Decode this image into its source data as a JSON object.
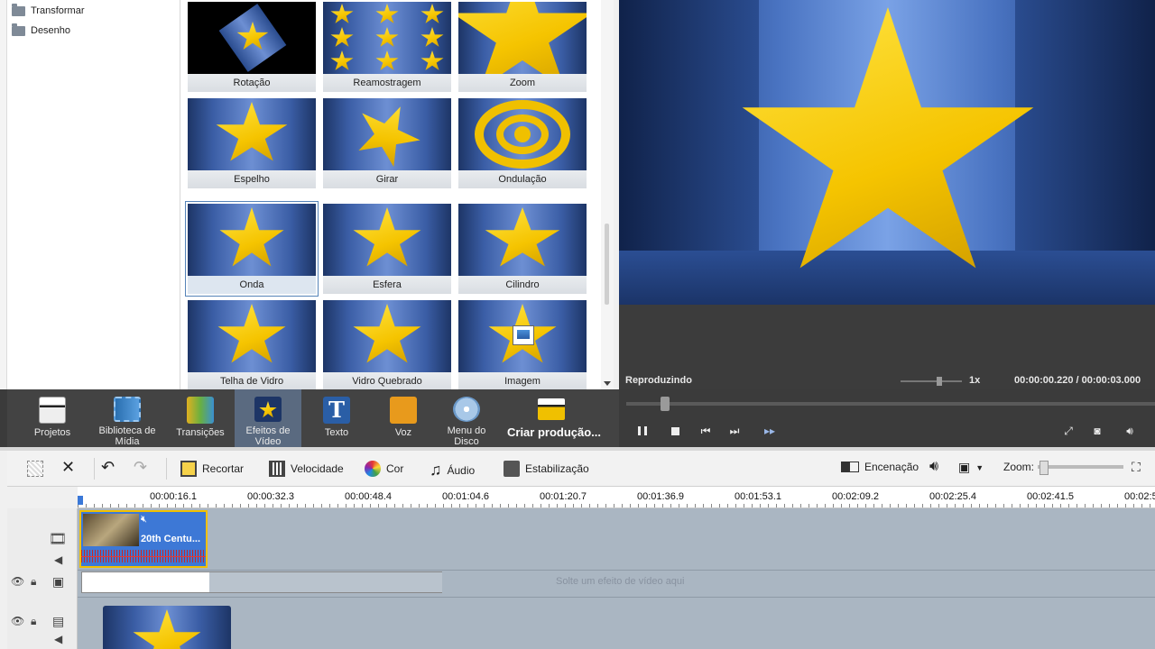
{
  "tree": {
    "items": [
      {
        "label": "Transformar"
      },
      {
        "label": "Desenho"
      }
    ]
  },
  "effects": {
    "tiles": [
      {
        "label": "Rotação"
      },
      {
        "label": "Reamostragem"
      },
      {
        "label": "Zoom"
      },
      {
        "label": "Espelho"
      },
      {
        "label": "Girar"
      },
      {
        "label": "Ondulação"
      },
      {
        "label": "Onda"
      },
      {
        "label": "Esfera"
      },
      {
        "label": "Cilindro"
      },
      {
        "label": "Telha de Vidro"
      },
      {
        "label": "Vidro Quebrado"
      },
      {
        "label": "Imagem"
      }
    ],
    "selected": "Onda"
  },
  "preview": {
    "status": "Reproduzindo",
    "speed": "1x",
    "current_time": "00:00:00.220",
    "separator": "/",
    "total_time": "00:00:03.000"
  },
  "main_toolbar": {
    "projetos": "Projetos",
    "biblioteca": "Biblioteca de Mídia",
    "transicoes": "Transições",
    "efeitos": "Efeitos de Vídeo",
    "texto": "Texto",
    "voz": "Voz",
    "menu_disco": "Menu do Disco",
    "criar": "Criar produção..."
  },
  "edit_toolbar": {
    "recortar": "Recortar",
    "velocidade": "Velocidade",
    "cor": "Cor",
    "audio": "Áudio",
    "estabilizacao": "Estabilização",
    "encenacao": "Encenação",
    "zoom": "Zoom:"
  },
  "timeline": {
    "ticks": [
      "00:00:16.1",
      "00:00:32.3",
      "00:00:48.4",
      "00:01:04.6",
      "00:01:20.7",
      "00:01:36.9",
      "00:01:53.1",
      "00:02:09.2",
      "00:02:25.4",
      "00:02:41.5",
      "00:02:5"
    ],
    "clip_title": "20th Centu...",
    "fx_hint": "Solte um efeito de vídeo aqui"
  },
  "colors": {
    "accent": "#3d78d6",
    "clip_border": "#f0c000",
    "star": "#f5c400"
  }
}
